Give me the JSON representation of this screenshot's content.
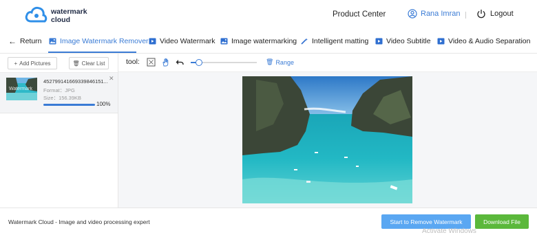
{
  "header": {
    "logo_line1": "watermark",
    "logo_line2": "cloud",
    "product_center": "Product Center",
    "user_name": "Rana Imran",
    "logout": "Logout"
  },
  "nav": {
    "return": "Return",
    "items": [
      {
        "label": "Image Watermark Remover",
        "icon": "image-icon",
        "active": true
      },
      {
        "label": "Video Watermark",
        "icon": "video-icon"
      },
      {
        "label": "Image watermarking",
        "icon": "image-icon"
      },
      {
        "label": "Intelligent matting",
        "icon": "magic-wand-icon"
      },
      {
        "label": "Video Subtitle",
        "icon": "video-icon"
      },
      {
        "label": "Video & Audio Separation",
        "icon": "video-icon"
      }
    ]
  },
  "left_panel": {
    "add_pictures": "Add Pictures",
    "clear_list": "Clear List",
    "file": {
      "name": "452799141669339846151...",
      "format": "Format：JPG",
      "size": "Size：156.39KB",
      "progress": 1.0,
      "progress_label": "100%",
      "thumb_watermark": "Watermark"
    }
  },
  "toolbar": {
    "label": "tool:",
    "brush_level": 0.12,
    "range": "Range"
  },
  "footer": {
    "tagline": "Watermark Cloud - Image and video processing expert",
    "start_button": "Start to Remove Watermark",
    "download_button": "Download File",
    "activate_text": "Activate Windows"
  },
  "colors": {
    "accent": "#3a7bd5",
    "start_button": "#5aa7f2",
    "download_button": "#5bb83b"
  }
}
